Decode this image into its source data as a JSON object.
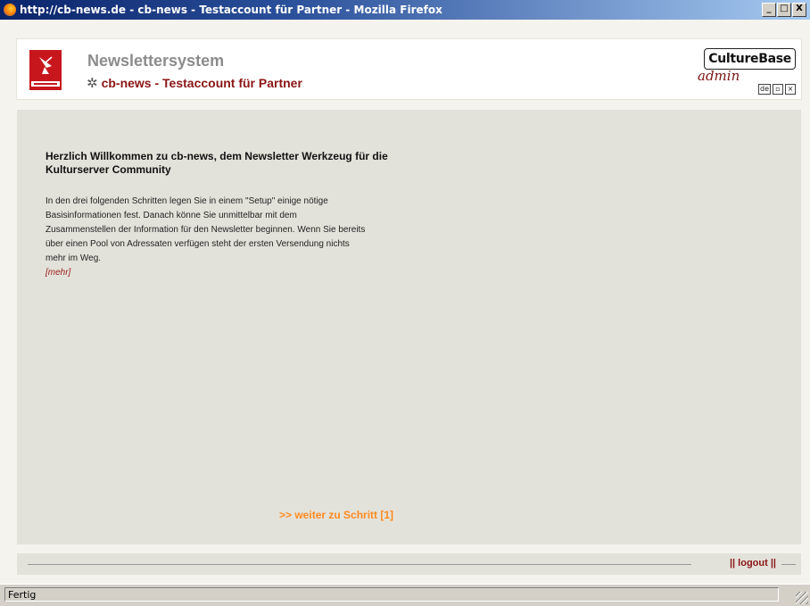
{
  "window": {
    "title": "http://cb-news.de - cb-news - Testaccount für Partner - Mozilla Firefox",
    "controls": [
      "_",
      "□",
      "X"
    ]
  },
  "header": {
    "system_title": "Newslettersystem",
    "subtitle": "cb-news - Testaccount für Partner",
    "star_glyph": "✲",
    "brand_logo": "CultureBase",
    "brand_admin": "admin",
    "language_badge": "de",
    "colors": {
      "accent": "#8a1515",
      "logo_red": "#c8161d"
    }
  },
  "main": {
    "welcome_heading": "Herzlich Willkommen zu cb-news, dem Newsletter Werkzeug für die Kulturserver Community",
    "intro_text": "In den drei folgenden Schritten legen Sie in einem \"Setup\" einige nötige Basisinformationen fest. Danach könne Sie unmittelbar mit dem Zusammenstellen der Information für den Newsletter beginnen. Wenn Sie bereits über einen Pool von Adressaten verfügen steht der ersten Versendung nichts mehr im Weg.",
    "more_link": "[mehr]",
    "next_link": ">> weiter zu Schritt [1]",
    "colors": {
      "next": "#ff8a1e",
      "panel_bg": "#e3e2da"
    }
  },
  "footer": {
    "logout_label": "|| logout ||"
  },
  "statusbar": {
    "text": "Fertig"
  }
}
